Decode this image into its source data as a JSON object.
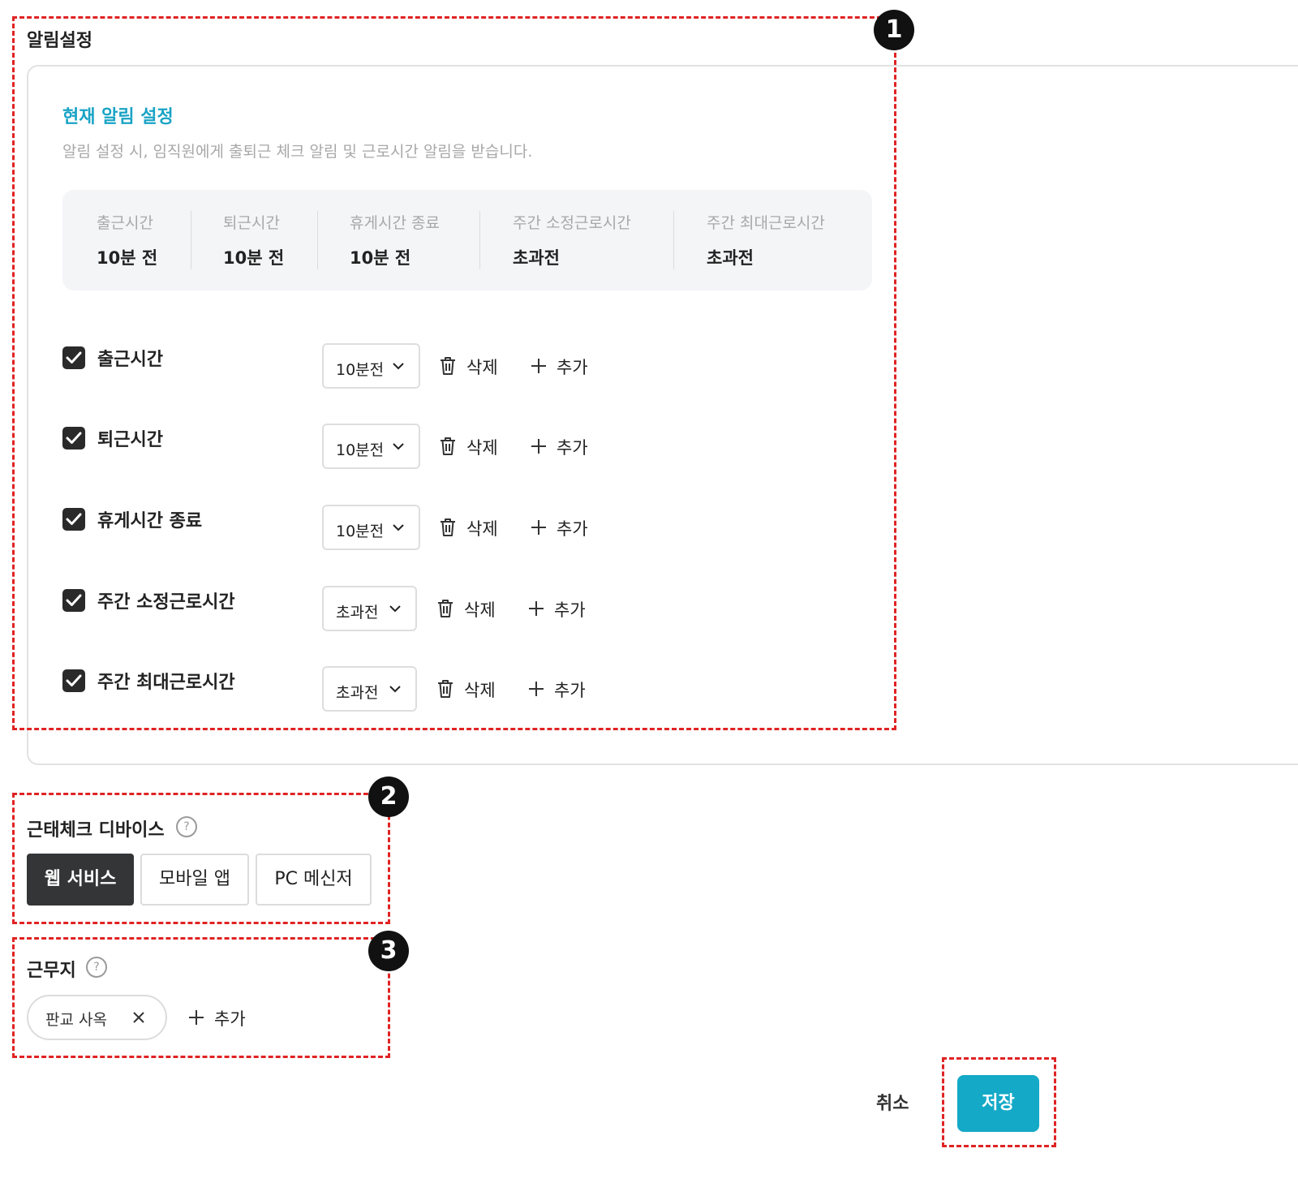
{
  "alarm": {
    "title": "알림설정",
    "current_title": "현재 알림 설정",
    "current_desc": "알림 설정 시, 임직원에게 출퇴근 체크 알림 및 근로시간 알림을 받습니다.",
    "summary": [
      {
        "label": "출근시간",
        "value": "10분 전"
      },
      {
        "label": "퇴근시간",
        "value": "10분 전"
      },
      {
        "label": "휴게시간 종료",
        "value": "10분 전"
      },
      {
        "label": "주간 소정근로시간",
        "value": "초과전"
      },
      {
        "label": "주간 최대근로시간",
        "value": "초과전"
      }
    ],
    "rows": [
      {
        "label": "출근시간",
        "checked": true,
        "select": "10분전",
        "delete": "삭제",
        "add": "추가"
      },
      {
        "label": "퇴근시간",
        "checked": true,
        "select": "10분전",
        "delete": "삭제",
        "add": "추가"
      },
      {
        "label": "휴게시간 종료",
        "checked": true,
        "select": "10분전",
        "delete": "삭제",
        "add": "추가"
      },
      {
        "label": "주간 소정근로시간",
        "checked": true,
        "select": "초과전",
        "delete": "삭제",
        "add": "추가"
      },
      {
        "label": "주간 최대근로시간",
        "checked": true,
        "select": "초과전",
        "delete": "삭제",
        "add": "추가"
      }
    ]
  },
  "device": {
    "title": "근태체크 디바이스",
    "help": "?",
    "options": [
      {
        "label": "웹 서비스",
        "active": true
      },
      {
        "label": "모바일 앱",
        "active": false
      },
      {
        "label": "PC 메신저",
        "active": false
      }
    ]
  },
  "workplace": {
    "title": "근무지",
    "help": "?",
    "chip": "판교 사옥",
    "add": "추가"
  },
  "footer": {
    "cancel": "취소",
    "save": "저장"
  },
  "annotations": [
    "1",
    "2",
    "3"
  ],
  "colors": {
    "accent": "#14a9c7",
    "annotation": "#e02323",
    "active_segment": "#333537"
  }
}
